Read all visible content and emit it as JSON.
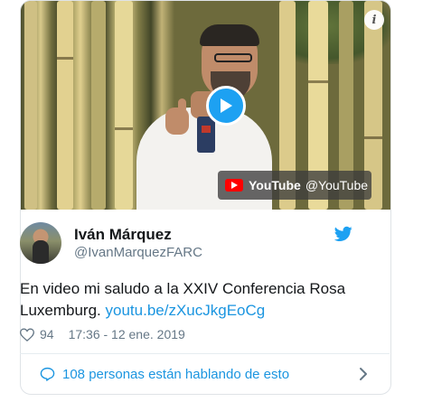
{
  "video": {
    "source_name": "YouTube",
    "source_handle": "@YouTube",
    "icons": {
      "play": "play-icon",
      "info": "info-icon",
      "youtube": "youtube-logo-icon"
    }
  },
  "tweet": {
    "author_name": "Iván Márquez",
    "author_handle": "@IvanMarquezFARC",
    "text": "En video mi saludo a la XXIV Conferencia Rosa Luxemburg.",
    "link": "youtu.be/zXucJkgEoCg",
    "likes": "94",
    "timestamp": "17:36 - 12 ene. 2019",
    "footer_text": "108 personas están hablando de esto"
  },
  "colors": {
    "twitter_blue": "#1da1f2",
    "link_blue": "#1b95e0",
    "muted_gray": "#657786",
    "youtube_red": "#ff0000"
  }
}
